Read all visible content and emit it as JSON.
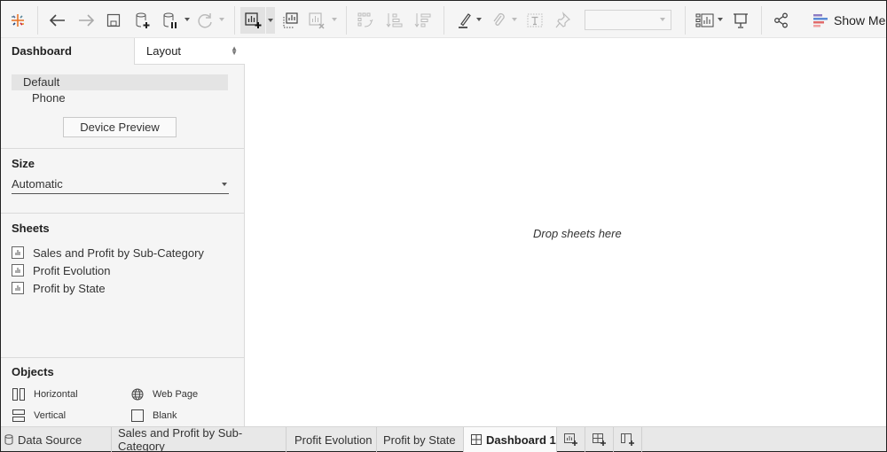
{
  "toolbar": {
    "icons": [
      {
        "name": "tableau-logo-icon",
        "enabled": true
      },
      {
        "name": "undo-icon",
        "enabled": true
      },
      {
        "name": "redo-icon",
        "enabled": false
      },
      {
        "name": "save-icon",
        "enabled": true
      },
      {
        "name": "new-data-source-icon",
        "enabled": true
      },
      {
        "name": "pause-auto-updates-icon",
        "enabled": true
      },
      {
        "name": "refresh-data-source-icon",
        "enabled": false
      },
      {
        "name": "new-worksheet-icon",
        "enabled": true
      },
      {
        "name": "duplicate-sheet-icon",
        "enabled": true
      },
      {
        "name": "clear-sheet-icon",
        "enabled": false
      },
      {
        "name": "swap-rows-columns-icon",
        "enabled": false
      },
      {
        "name": "sort-ascending-icon",
        "enabled": false
      },
      {
        "name": "sort-descending-icon",
        "enabled": false
      },
      {
        "name": "highlight-icon",
        "enabled": true
      },
      {
        "name": "group-members-icon",
        "enabled": false
      },
      {
        "name": "show-mark-labels-icon",
        "enabled": false
      },
      {
        "name": "fix-axes-icon",
        "enabled": false
      },
      {
        "name": "show-cards-icon",
        "enabled": true
      },
      {
        "name": "presentation-mode-icon",
        "enabled": true
      },
      {
        "name": "share-icon",
        "enabled": true
      }
    ],
    "fit_select_value": "",
    "show_me_label": "Show Me",
    "show_me_colors": [
      "#8e7cc3",
      "#5b8bd6",
      "#e06b6b",
      "#f0a0a0"
    ]
  },
  "panel": {
    "tab_dashboard": "Dashboard",
    "tab_layout": "Layout",
    "devices": {
      "default": "Default",
      "phone": "Phone"
    },
    "device_preview_button": "Device Preview",
    "size": {
      "title": "Size",
      "value": "Automatic"
    },
    "sheets": {
      "title": "Sheets",
      "items": [
        "Sales and Profit by Sub-Category",
        "Profit Evolution",
        "Profit by State"
      ]
    },
    "objects": {
      "title": "Objects",
      "items": [
        {
          "label": "Horizontal",
          "icon": "horizontal-container-icon"
        },
        {
          "label": "Web Page",
          "icon": "web-page-icon"
        },
        {
          "label": "Vertical",
          "icon": "vertical-container-icon"
        },
        {
          "label": "Blank",
          "icon": "blank-icon"
        }
      ]
    }
  },
  "canvas": {
    "drop_hint": "Drop sheets here"
  },
  "tabs": {
    "items": [
      {
        "label": "Data Source",
        "type": "datasource"
      },
      {
        "label": "Sales and Profit by Sub-Category",
        "type": "sheet"
      },
      {
        "label": "Profit Evolution",
        "type": "sheet"
      },
      {
        "label": "Profit by State",
        "type": "sheet"
      },
      {
        "label": "Dashboard 1",
        "type": "dashboard",
        "active": true
      }
    ],
    "new_worksheet": "new-worksheet-tab-icon",
    "new_dashboard": "new-dashboard-tab-icon",
    "new_story": "new-story-tab-icon"
  },
  "colors": {
    "toolbar_bg": "#f5f5f5",
    "panel_bg": "#f5f5f5",
    "selected_device_bg": "#e4e4e4",
    "tabs_bg": "#e8e8e8"
  }
}
